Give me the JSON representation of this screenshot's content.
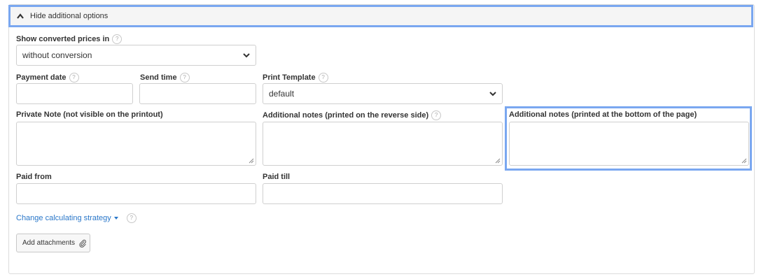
{
  "toggle": {
    "label": "Hide additional options",
    "icon": "chevron-up-icon"
  },
  "converted_prices": {
    "label": "Show converted prices in",
    "help": "?",
    "value": "without conversion"
  },
  "payment_date": {
    "label": "Payment date",
    "help": "?",
    "value": ""
  },
  "send_time": {
    "label": "Send time",
    "help": "?",
    "value": ""
  },
  "print_template": {
    "label": "Print Template",
    "help": "?",
    "value": "default"
  },
  "private_note": {
    "label": "Private Note (not visible on the printout)",
    "value": ""
  },
  "notes_reverse": {
    "label": "Additional notes (printed on the reverse side)",
    "help": "?",
    "value": ""
  },
  "notes_bottom": {
    "label": "Additional notes (printed at the bottom of the page)",
    "value": ""
  },
  "paid_from": {
    "label": "Paid from",
    "value": ""
  },
  "paid_till": {
    "label": "Paid till",
    "value": ""
  },
  "strategy": {
    "label": "Change calculating strategy",
    "help": "?"
  },
  "attachments": {
    "label": "Add attachments",
    "icon": "paperclip-icon"
  },
  "colors": {
    "accent_focus": "#7aa7f0",
    "link": "#2a77c9"
  }
}
